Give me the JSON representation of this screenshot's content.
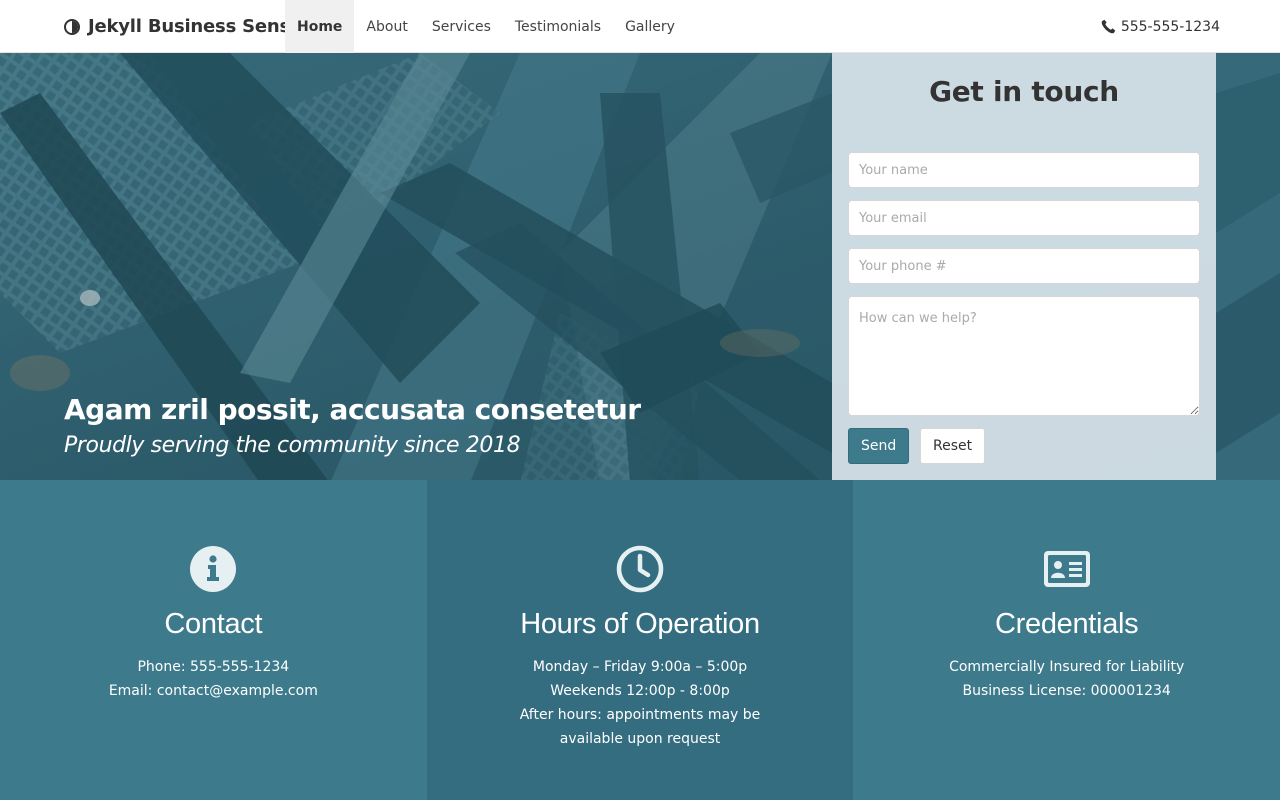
{
  "navbar": {
    "brand": "Jekyll Business Sense",
    "brand_icon": "half-circle-icon",
    "items": [
      "Home",
      "About",
      "Services",
      "Testimonials",
      "Gallery"
    ],
    "active_index": 0,
    "phone": "555-555-1234",
    "phone_icon": "phone-icon"
  },
  "hero": {
    "title": "Agam zril possit, accusata consetetur",
    "subtitle": "Proudly serving the community since 2018"
  },
  "contact_form": {
    "title": "Get in touch",
    "name_placeholder": "Your name",
    "email_placeholder": "Your email",
    "phone_placeholder": "Your phone #",
    "message_placeholder": "How can we help?",
    "send_label": "Send",
    "reset_label": "Reset"
  },
  "features": [
    {
      "icon": "info-icon",
      "title": "Contact",
      "lines": [
        "Phone: 555-555-1234",
        "Email: contact@example.com"
      ]
    },
    {
      "icon": "clock-icon",
      "title": "Hours of Operation",
      "lines": [
        "Monday – Friday 9:00a – 5:00p",
        "Weekends 12:00p - 8:00p",
        "After hours: appointments may be available upon request"
      ]
    },
    {
      "icon": "id-card-icon",
      "title": "Credentials",
      "lines": [
        "Commercially Insured for Liability",
        "Business License: 000001234"
      ]
    }
  ],
  "colors": {
    "accent": "#3d7a8c",
    "accent_dark": "#346d7f",
    "form_panel": "#dee8ee"
  }
}
